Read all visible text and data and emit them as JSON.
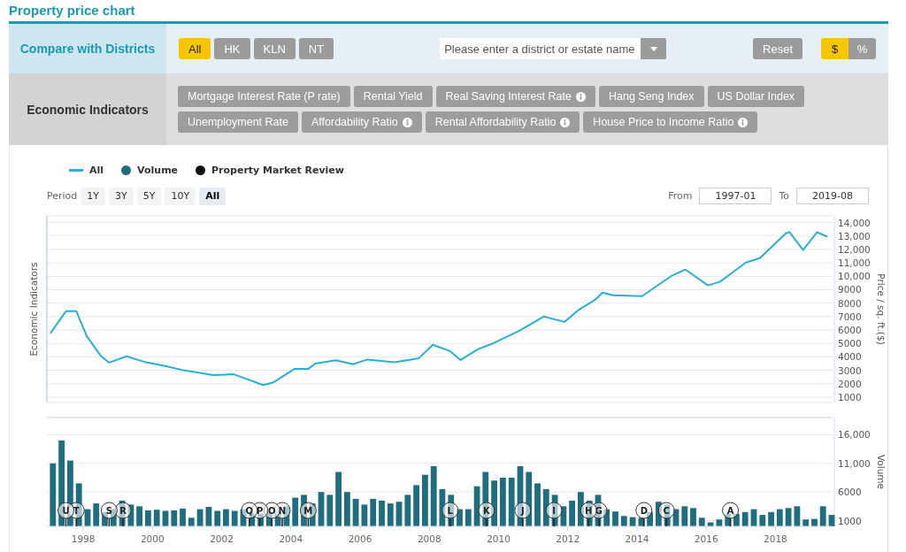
{
  "title": "Property price chart",
  "districts": {
    "label": "Compare with Districts",
    "options": [
      {
        "label": "All",
        "selected": true
      },
      {
        "label": "HK",
        "selected": false
      },
      {
        "label": "KLN",
        "selected": false
      },
      {
        "label": "NT",
        "selected": false
      }
    ],
    "search": {
      "placeholder": "Please enter a district or estate name"
    },
    "reset": "Reset",
    "units": [
      {
        "label": "$",
        "selected": true
      },
      {
        "label": "%",
        "selected": false
      }
    ]
  },
  "indicators": {
    "label": "Economic Indicators",
    "items": [
      {
        "label": "Mortgage Interest Rate (P rate)",
        "info": false
      },
      {
        "label": "Rental Yield",
        "info": false
      },
      {
        "label": "Real Saving Interest Rate",
        "info": true
      },
      {
        "label": "Hang Seng Index",
        "info": false
      },
      {
        "label": "US Dollar Index",
        "info": false
      },
      {
        "label": "Unemployment Rate",
        "info": false
      },
      {
        "label": "Affordability Ratio",
        "info": true
      },
      {
        "label": "Rental Affordability Ratio",
        "info": true
      },
      {
        "label": "House Price to Income Ratio",
        "info": true
      }
    ]
  },
  "legend": [
    {
      "label": "Property Market Review",
      "kind": "dot",
      "color": "#111111"
    }
  ],
  "period": {
    "label": "Period",
    "options": [
      {
        "label": "1Y",
        "selected": false
      },
      {
        "label": "3Y",
        "selected": false
      },
      {
        "label": "5Y",
        "selected": false
      },
      {
        "label": "10Y",
        "selected": false
      },
      {
        "label": "All",
        "selected": true
      }
    ]
  },
  "range": {
    "from_label": "From",
    "from": "1997-01",
    "to_label": "To",
    "to": "2019-08"
  },
  "price_chart": {
    "left_axis_title": "Economic Indicators",
    "chart_data": {
      "type": "line",
      "grid": true,
      "ylabel": "Price / sq. ft.($)",
      "x": [
        1997.05,
        1997.5,
        1997.8,
        1998.1,
        1998.5,
        1998.75,
        1999.25,
        1999.75,
        2000.4,
        2000.9,
        2001.75,
        2002.35,
        2003.2,
        2003.5,
        2004.1,
        2004.5,
        2004.7,
        2005.3,
        2005.8,
        2006.2,
        2007.0,
        2007.7,
        2008.1,
        2008.6,
        2008.9,
        2009.4,
        2009.8,
        2010.6,
        2011.0,
        2011.3,
        2011.9,
        2012.3,
        2012.8,
        2013.0,
        2013.3,
        2014.15,
        2015.0,
        2015.4,
        2016.05,
        2016.4,
        2016.8,
        2017.15,
        2017.55,
        2018.3,
        2018.4,
        2018.8,
        2019.2,
        2019.5
      ],
      "series": [
        {
          "name": "All",
          "color": "#2bafd0",
          "values": [
            5750,
            7400,
            7400,
            5550,
            4100,
            3570,
            4040,
            3640,
            3300,
            3000,
            2650,
            2700,
            1900,
            2100,
            3100,
            3100,
            3500,
            3750,
            3450,
            3800,
            3600,
            3900,
            4900,
            4430,
            3770,
            4560,
            4960,
            5950,
            6540,
            7000,
            6600,
            7470,
            8260,
            8790,
            8590,
            8520,
            10040,
            10500,
            9320,
            9600,
            10370,
            11030,
            11360,
            13200,
            13300,
            11960,
            13280,
            12950
          ]
        }
      ],
      "xlim": [
        1996.95,
        2019.65
      ],
      "ylim": [
        600,
        14500
      ],
      "yticks": [
        1000,
        2000,
        3000,
        4000,
        5000,
        6000,
        7000,
        8000,
        9000,
        {
          "value": 10000,
          "label": "10,000"
        },
        {
          "value": 11000,
          "label": "11,000"
        },
        {
          "value": 12000,
          "label": "12,000"
        },
        {
          "value": 13000,
          "label": "13,000"
        },
        {
          "value": 14000,
          "label": "14,000"
        }
      ]
    }
  },
  "volume_chart": {
    "chart_data": {
      "type": "bar",
      "grid": true,
      "ylabel": "Volume",
      "x": [
        1997.125,
        1997.375,
        1997.625,
        1997.875,
        1998.125,
        1998.375,
        1998.625,
        1998.875,
        1999.125,
        1999.375,
        1999.625,
        1999.875,
        2000.125,
        2000.375,
        2000.625,
        2000.875,
        2001.125,
        2001.375,
        2001.625,
        2001.875,
        2002.125,
        2002.375,
        2002.625,
        2002.875,
        2003.125,
        2003.375,
        2003.625,
        2003.875,
        2004.125,
        2004.375,
        2004.625,
        2004.875,
        2005.125,
        2005.375,
        2005.625,
        2005.875,
        2006.125,
        2006.375,
        2006.625,
        2006.875,
        2007.125,
        2007.375,
        2007.625,
        2007.875,
        2008.125,
        2008.375,
        2008.625,
        2008.875,
        2009.125,
        2009.375,
        2009.625,
        2009.875,
        2010.125,
        2010.375,
        2010.625,
        2010.875,
        2011.125,
        2011.375,
        2011.625,
        2011.875,
        2012.125,
        2012.375,
        2012.625,
        2012.875,
        2013.125,
        2013.375,
        2013.625,
        2013.875,
        2014.125,
        2014.375,
        2014.625,
        2014.875,
        2015.125,
        2015.375,
        2015.625,
        2015.875,
        2016.125,
        2016.375,
        2016.625,
        2016.875,
        2017.125,
        2017.375,
        2017.625,
        2017.875,
        2018.125,
        2018.375,
        2018.625,
        2018.875,
        2019.125,
        2019.375,
        2019.625
      ],
      "series": [
        {
          "name": "Volume",
          "color": "#1f6e7f",
          "values": [
            11000,
            15000,
            11500,
            7500,
            3000,
            4000,
            2500,
            3000,
            4500,
            3800,
            3500,
            2800,
            2900,
            2700,
            2800,
            3100,
            1500,
            3000,
            3400,
            2700,
            3000,
            2700,
            3000,
            2500,
            2200,
            2500,
            3000,
            3500,
            5000,
            5500,
            4000,
            6000,
            5500,
            9500,
            6000,
            4800,
            3800,
            4800,
            4500,
            4000,
            4300,
            5500,
            7200,
            9000,
            10500,
            6500,
            5500,
            3000,
            3000,
            7000,
            9500,
            8000,
            8500,
            8500,
            10500,
            9500,
            7500,
            6500,
            5500,
            3500,
            4500,
            6000,
            4500,
            5500,
            3000,
            2600,
            1800,
            1600,
            1500,
            2500,
            4300,
            3800,
            3000,
            3500,
            3200,
            1500,
            700,
            1200,
            2200,
            2200,
            2500,
            3000,
            2000,
            2500,
            3000,
            3200,
            3500,
            1200,
            1300,
            3500,
            2000
          ]
        }
      ],
      "xlim": [
        1996.95,
        2019.65
      ],
      "ylim": [
        0,
        19000
      ],
      "xticks": [
        1998,
        2000,
        2002,
        2004,
        2006,
        2008,
        2010,
        2012,
        2014,
        2016,
        2018
      ],
      "yticks": [
        1000,
        6000,
        {
          "value": 11000,
          "label": "11,000"
        },
        {
          "value": 16000,
          "label": "16,000"
        }
      ],
      "annotations": [
        {
          "x": 1997.5,
          "text": "U"
        },
        {
          "x": 1997.8,
          "text": "T"
        },
        {
          "x": 1998.75,
          "text": "S"
        },
        {
          "x": 1999.15,
          "text": "R"
        },
        {
          "x": 2002.8,
          "text": "Q"
        },
        {
          "x": 2003.1,
          "text": "P"
        },
        {
          "x": 2003.45,
          "text": "O"
        },
        {
          "x": 2003.75,
          "text": "N"
        },
        {
          "x": 2004.5,
          "text": "M"
        },
        {
          "x": 2008.6,
          "text": "L"
        },
        {
          "x": 2009.65,
          "text": "K"
        },
        {
          "x": 2010.7,
          "text": "J"
        },
        {
          "x": 2011.6,
          "text": "I"
        },
        {
          "x": 2012.6,
          "text": "H"
        },
        {
          "x": 2012.9,
          "text": "G"
        },
        {
          "x": 2014.2,
          "text": "D"
        },
        {
          "x": 2014.85,
          "text": "C"
        },
        {
          "x": 2016.7,
          "text": "A"
        }
      ]
    }
  }
}
